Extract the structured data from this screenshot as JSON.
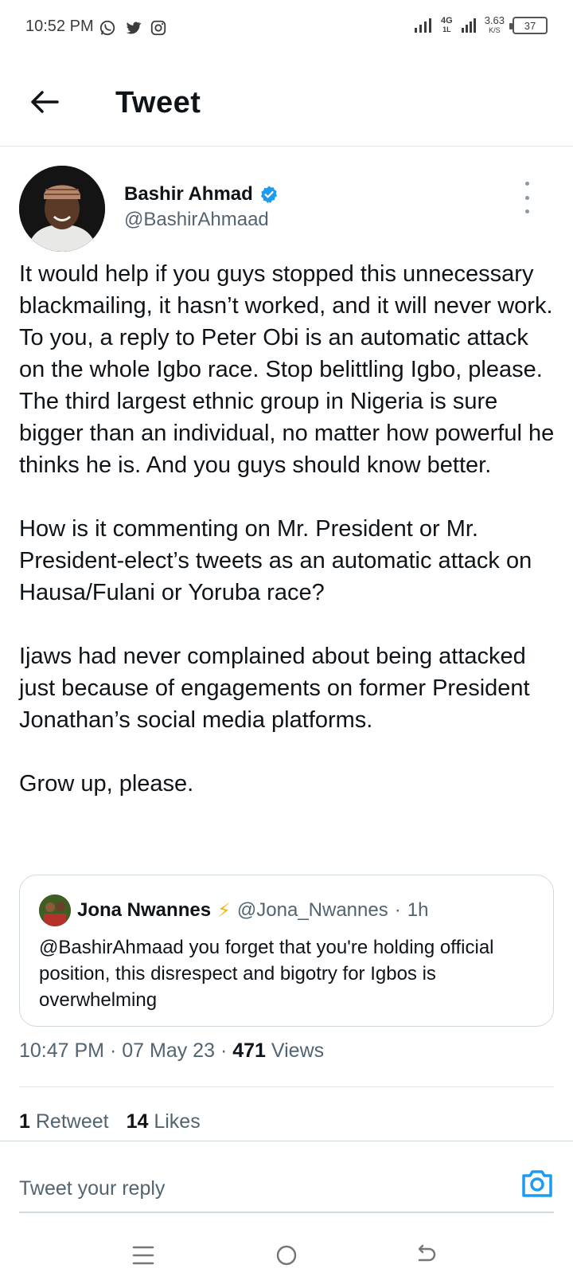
{
  "status_bar": {
    "time": "10:52 PM",
    "network": "4G",
    "network_sub": "1L",
    "speed_value": "3.63",
    "speed_unit": "K/S",
    "battery": "37"
  },
  "header": {
    "title": "Tweet"
  },
  "author": {
    "name": "Bashir Ahmad",
    "handle": "@BashirAhmaad",
    "verified": true
  },
  "tweet": {
    "paragraphs": [
      "It would help if you guys stopped this unnecessary blackmailing, it hasn’t worked, and it will never work. To you, a reply to Peter Obi is an automatic attack on the whole Igbo race. Stop belittling Igbo, please. The third largest ethnic group in Nigeria is sure bigger than an individual, no matter how powerful he thinks he is. And you guys should know better.",
      "How is it commenting on Mr. President or Mr. President-elect’s tweets as an automatic attack on Hausa/Fulani or Yoruba race?",
      "Ijaws had never complained about being attacked just because of engagements on former President Jonathan’s social media platforms.",
      "Grow up, please."
    ],
    "time": "10:47 PM",
    "date": "07 May 23",
    "views_count": "471",
    "views_label": "Views",
    "separator": "·"
  },
  "quote": {
    "name": "Jona Nwannes",
    "emoji": "⚡",
    "handle": "@Jona_Nwannes",
    "time": "1h",
    "separator": "·",
    "text": "@BashirAhmaad you forget that you're holding official position, this disrespect and bigotry for Igbos is overwhelming"
  },
  "stats": {
    "retweets_count": "1",
    "retweets_label": "Retweet",
    "likes_count": "14",
    "likes_label": "Likes"
  },
  "reply": {
    "placeholder": "Tweet your reply"
  },
  "colors": {
    "accent": "#1d9bf0",
    "text_primary": "#0f1419",
    "text_secondary": "#536471",
    "border": "#cfd9de"
  },
  "icons": {
    "back": "arrow-left-icon",
    "verified": "verified-badge-icon",
    "more": "more-vertical-icon",
    "camera": "camera-icon",
    "nav_menu": "menu-icon",
    "nav_home": "home-circle-icon",
    "nav_back": "back-gesture-icon"
  }
}
